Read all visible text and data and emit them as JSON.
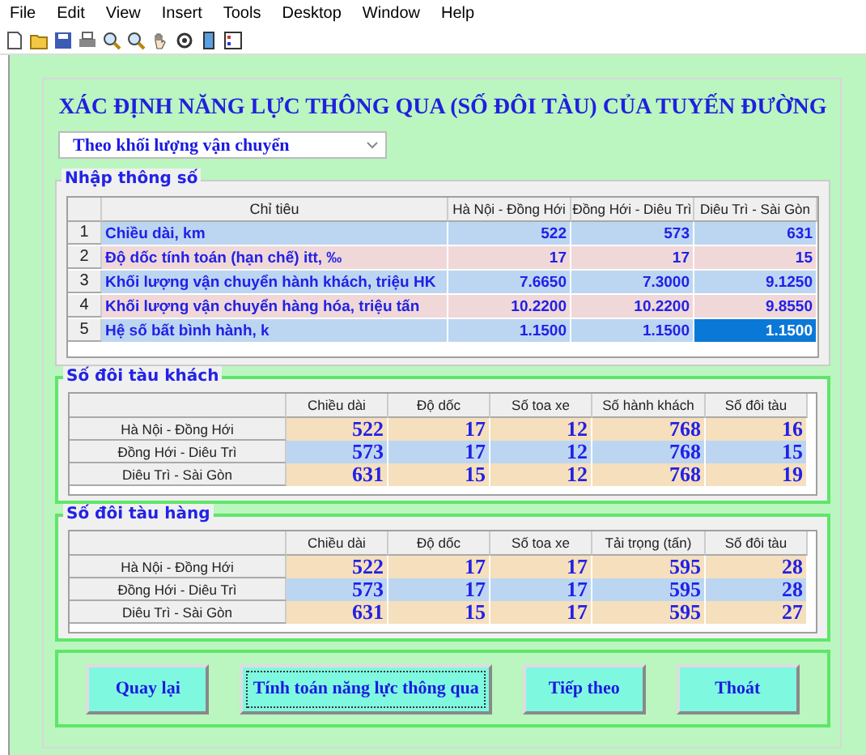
{
  "menu": [
    "File",
    "Edit",
    "View",
    "Insert",
    "Tools",
    "Desktop",
    "Window",
    "Help"
  ],
  "title": "XÁC ĐỊNH NĂNG LỰC THÔNG QUA (SỐ ĐÔI TÀU) CỦA TUYẾN ĐƯỜNG",
  "mode_dropdown": {
    "value": "Theo khối lượng vận chuyển"
  },
  "input_panel": {
    "legend": "Nhập thông số",
    "label_column": "Chỉ tiêu",
    "value_columns": [
      "Hà Nội - Đồng Hới",
      "Đồng Hới - Diêu Trì",
      "Diêu Trì - Sài Gòn"
    ],
    "rows": [
      {
        "number": "1",
        "label": "Chiều dài, km",
        "color": "#bcd6f2",
        "cells": [
          {
            "text": "522",
            "selected": false
          },
          {
            "text": "573",
            "selected": false
          },
          {
            "text": "631",
            "selected": false
          }
        ]
      },
      {
        "number": "2",
        "label": "Độ dốc tính toán (hạn chế) itt, ‰",
        "color": "#f0d8d8",
        "cells": [
          {
            "text": "17",
            "selected": false
          },
          {
            "text": "17",
            "selected": false
          },
          {
            "text": "15",
            "selected": false
          }
        ]
      },
      {
        "number": "3",
        "label": "Khối lượng vận chuyển hành khách, triệu HK",
        "color": "#bcd6f2",
        "cells": [
          {
            "text": "7.6650",
            "selected": false
          },
          {
            "text": "7.3000",
            "selected": false
          },
          {
            "text": "9.1250",
            "selected": false
          }
        ]
      },
      {
        "number": "4",
        "label": "Khối lượng vận chuyển hàng hóa, triệu tấn",
        "color": "#f0d8d8",
        "cells": [
          {
            "text": "10.2200",
            "selected": false
          },
          {
            "text": "10.2200",
            "selected": false
          },
          {
            "text": "9.8550",
            "selected": false
          }
        ]
      },
      {
        "number": "5",
        "label": "Hệ số bất bình hành, k",
        "color": "#bcd6f2",
        "cells": [
          {
            "text": "1.1500",
            "selected": false
          },
          {
            "text": "1.1500",
            "selected": false
          },
          {
            "text": "1.1500",
            "selected": true
          }
        ]
      }
    ]
  },
  "result_panels": [
    {
      "legend": "Số đôi tàu khách",
      "columns": [
        "Chiều dài",
        "Độ dốc",
        "Số toa xe",
        "Số hành khách",
        "Số đôi tàu"
      ],
      "rows": [
        {
          "route": "Hà Nội - Đồng Hới",
          "color": "#f5dfbc",
          "values": [
            "522",
            "17",
            "12",
            "768",
            "16"
          ]
        },
        {
          "route": "Đồng Hới - Diêu Trì",
          "color": "#bcd6f2",
          "values": [
            "573",
            "17",
            "12",
            "768",
            "15"
          ]
        },
        {
          "route": "Diêu Trì - Sài Gòn",
          "color": "#f5dfbc",
          "values": [
            "631",
            "15",
            "12",
            "768",
            "19"
          ]
        }
      ]
    },
    {
      "legend": "Số đôi tàu hàng",
      "columns": [
        "Chiều dài",
        "Độ dốc",
        "Số toa xe",
        "Tải trọng (tấn)",
        "Số đôi tàu"
      ],
      "rows": [
        {
          "route": "Hà Nội - Đồng Hới",
          "color": "#f5dfbc",
          "values": [
            "522",
            "17",
            "17",
            "595",
            "28"
          ]
        },
        {
          "route": "Đồng Hới - Diêu Trì",
          "color": "#bcd6f2",
          "values": [
            "573",
            "17",
            "17",
            "595",
            "28"
          ]
        },
        {
          "route": "Diêu Trì - Sài Gòn",
          "color": "#f5dfbc",
          "values": [
            "631",
            "15",
            "17",
            "595",
            "27"
          ]
        }
      ]
    }
  ],
  "buttons": [
    {
      "label": "Quay lại",
      "focused": false
    },
    {
      "label": "Tính toán năng lực thông qua",
      "focused": true
    },
    {
      "label": "Tiếp theo",
      "focused": false
    },
    {
      "label": "Thoát",
      "focused": false
    }
  ]
}
